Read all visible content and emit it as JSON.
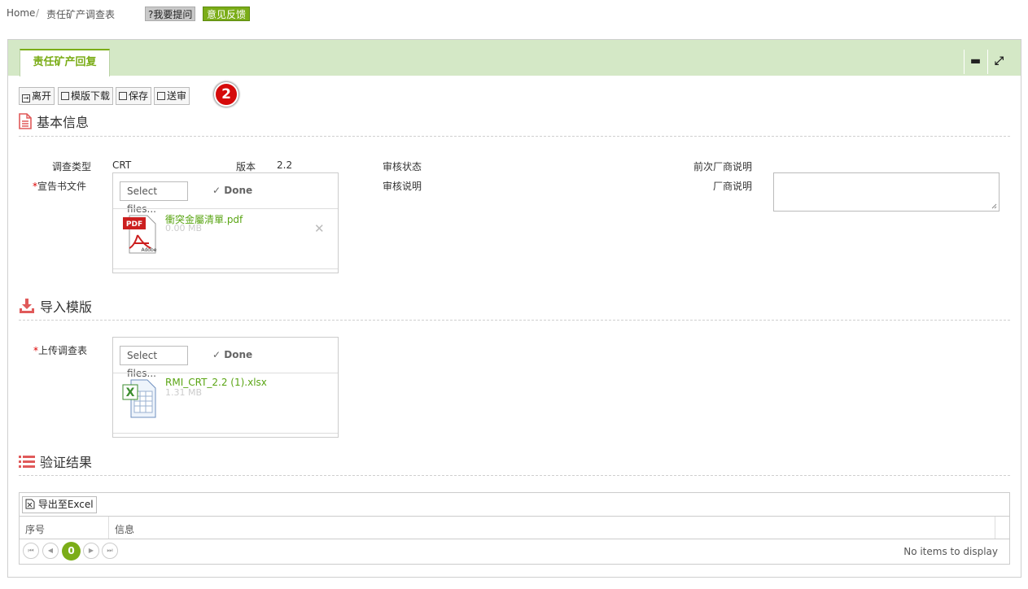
{
  "breadcrumb": {
    "home": "Home",
    "separator": "/",
    "current": "责任矿产调查表"
  },
  "top_buttons": {
    "ask": "?我要提问",
    "feedback": "意见反馈"
  },
  "panel": {
    "tab": "责任矿产回复",
    "minimize_icon": "minus-icon",
    "maximize_icon": "expand-icon"
  },
  "toolbar": {
    "leave": "离开",
    "template_download": "模版下载",
    "save": "保存",
    "submit": "送审",
    "step_badge": "2"
  },
  "basic_info": {
    "title": "基本信息",
    "survey_type_label": "调查类型",
    "survey_type_value": "CRT",
    "version_label": "版本",
    "version_value": "2.2",
    "review_status_label": "审核状态",
    "review_note_label": "审核说明",
    "prev_vendor_note_label": "前次厂商说明",
    "vendor_note_label": "厂商说明",
    "declaration_label": "宣告书文件",
    "declaration_upload": {
      "select_label": "Select files...",
      "done_label": "Done",
      "file_name": "衝突金屬清單.pdf",
      "file_size": "0.00 MB",
      "file_icon": "pdf-file-icon"
    }
  },
  "import": {
    "title": "导入模版",
    "upload_label": "上传调查表",
    "upload": {
      "select_label": "Select files...",
      "done_label": "Done",
      "file_name": "RMI_CRT_2.2 (1).xlsx",
      "file_size": "1.31 MB",
      "file_icon": "excel-file-icon"
    }
  },
  "validation": {
    "title": "验证结果",
    "export_label": "导出至Excel",
    "columns": [
      "序号",
      "信息"
    ],
    "pager": {
      "current_page": "0",
      "empty_text": "No items to display"
    }
  },
  "colors": {
    "accent": "#7bad18",
    "header_bg": "#d4e8c6",
    "section_icon": "#e05a5a",
    "badge": "#d50a0a"
  }
}
